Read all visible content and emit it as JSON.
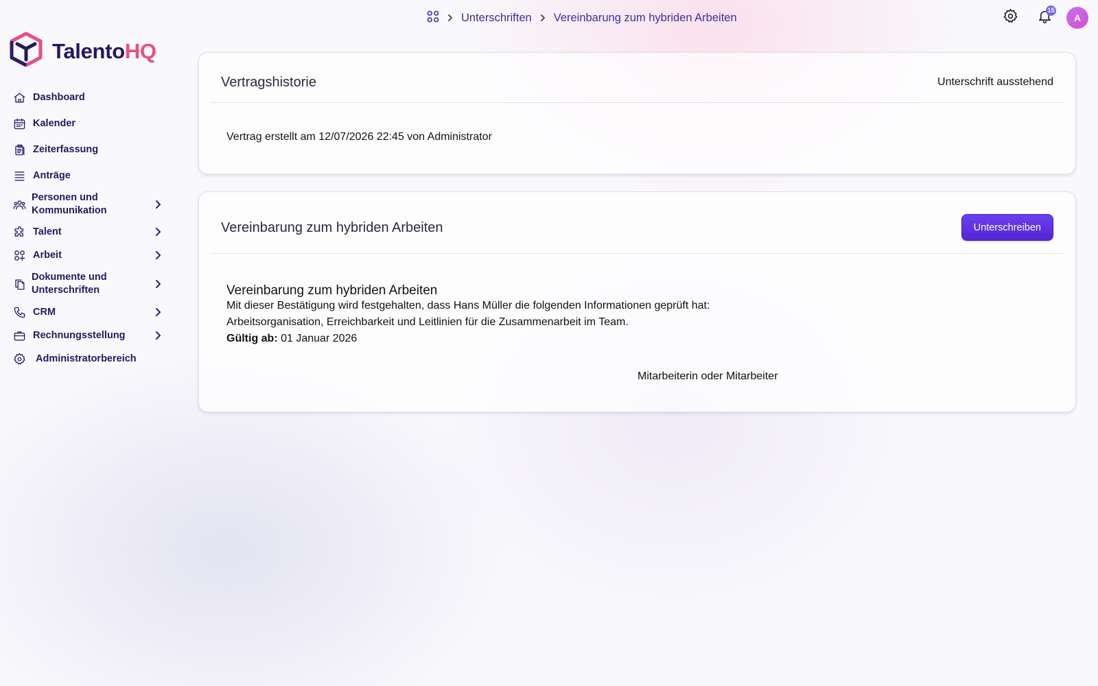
{
  "brand": {
    "name_part1": "Talento",
    "name_part2": "HQ",
    "logo_icon": "cube-logo-icon"
  },
  "breadcrumb": {
    "home_icon": "grid-icon",
    "items": [
      "Unterschriften",
      "Vereinbarung zum hybriden Arbeiten"
    ]
  },
  "topbar": {
    "settings_icon": "gear-icon",
    "notifications_icon": "bell-icon",
    "notification_count": "15",
    "avatar_initial": "A"
  },
  "sidebar": {
    "items": [
      {
        "label": "Dashboard",
        "icon": "home-icon",
        "has_submenu": false
      },
      {
        "label": "Kalender",
        "icon": "calendar-icon",
        "has_submenu": false
      },
      {
        "label": "Zeiterfassung",
        "icon": "clipboard-icon",
        "has_submenu": false
      },
      {
        "label": "Anträge",
        "icon": "list-icon",
        "has_submenu": false
      },
      {
        "label": "Personen und Kommunikation",
        "icon": "people-icon",
        "has_submenu": true
      },
      {
        "label": "Talent",
        "icon": "puzzle-icon",
        "has_submenu": true
      },
      {
        "label": "Arbeit",
        "icon": "apps-add-icon",
        "has_submenu": true
      },
      {
        "label": "Dokumente und Unterschriften",
        "icon": "documents-icon",
        "has_submenu": true
      },
      {
        "label": "CRM",
        "icon": "phone-icon",
        "has_submenu": true
      },
      {
        "label": "Rechnungsstellung",
        "icon": "briefcase-icon",
        "has_submenu": true
      },
      {
        "label": "Administratorbereich",
        "icon": "gear-icon",
        "has_submenu": false
      }
    ]
  },
  "history_card": {
    "title": "Vertragshistorie",
    "status": "Unterschrift ausstehend",
    "entry": "Vertrag erstellt am 12/07/2026 22:45 von Administrator"
  },
  "document_card": {
    "title": "Vereinbarung zum hybriden Arbeiten",
    "sign_button_label": "Unterschreiben",
    "doc_title": "Vereinbarung zum hybriden Arbeiten",
    "line1": "Mit dieser Bestätigung wird festgehalten, dass Hans Müller die folgenden Informationen geprüft hat:",
    "line2": "Arbeitsorganisation, Erreichbarkeit und Leitlinien für die Zusammenarbeit im Team.",
    "valid_label": "Gültig ab:",
    "valid_value": "01 Januar 2026",
    "signer_label": "Mitarbeiterin oder Mitarbeiter"
  },
  "colors": {
    "brand_dark": "#24185e",
    "brand_pink": "#e8507e",
    "accent_purple": "#5b2fe0",
    "link": "#3d2e9e"
  }
}
